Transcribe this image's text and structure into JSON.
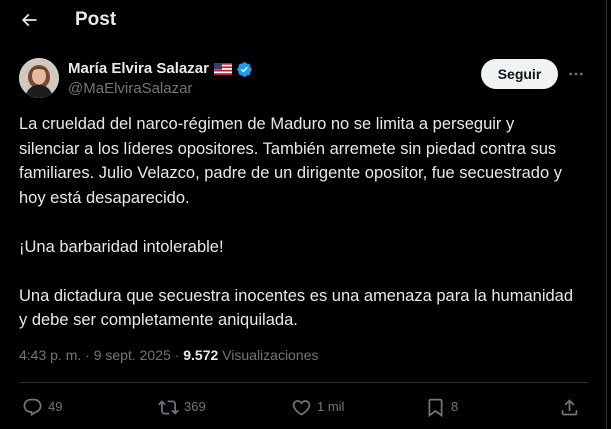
{
  "header": {
    "back_icon": "arrow-left-icon",
    "title": "Post"
  },
  "author": {
    "name": "María Elvira Salazar",
    "handle": "@MaElviraSalazar",
    "flag_icon": "us-flag-icon",
    "verified_icon": "verified-badge-icon",
    "follow_label": "Seguir",
    "more_icon": "more-horizontal-icon"
  },
  "post": {
    "paragraphs": [
      "La crueldad del narco-régimen de Maduro no se limita a perseguir y silenciar a los líderes opositores. También arremete sin piedad contra sus familiares. Julio Velazco, padre de un dirigente opositor, fue secuestrado y hoy está desaparecido.",
      "¡Una barbaridad intolerable!",
      "Una dictadura que secuestra inocentes es una amenaza para la humanidad y debe ser completamente aniquilada."
    ]
  },
  "meta": {
    "time": "4:43 p. m.",
    "separator": "·",
    "date": "9 sept. 2025",
    "views_count": "9.572",
    "views_label": "Visualizaciones"
  },
  "actions": {
    "reply": {
      "icon": "reply-icon",
      "count": "49"
    },
    "repost": {
      "icon": "repost-icon",
      "count": "369"
    },
    "like": {
      "icon": "heart-icon",
      "count": "1 mil"
    },
    "bookmark": {
      "icon": "bookmark-icon",
      "count": "8"
    },
    "share": {
      "icon": "share-icon"
    }
  },
  "colors": {
    "background": "#000000",
    "text_primary": "#e7e9ea",
    "text_secondary": "#71767b",
    "divider": "#2f3336",
    "verified_blue": "#1d9bf0",
    "follow_button_bg": "#eff3f4"
  }
}
